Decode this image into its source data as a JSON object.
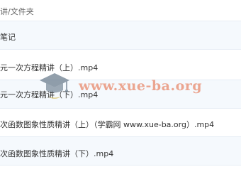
{
  "header": {
    "title": "讲/文件夹"
  },
  "files": [
    {
      "name": "笔记"
    },
    {
      "name": "元一次方程精讲（上）.mp4"
    },
    {
      "name": "元一次方程精讲（下）.mp4"
    },
    {
      "name": "次函数图象性质精讲（上）（学霸网 www.xue-ba.org）.mp4"
    },
    {
      "name": "次函数图象性质精讲（下）.mp4"
    }
  ],
  "watermark": {
    "text": "www.xue-ba.org",
    "icon": "graduation-cap-icon",
    "color": "#e8896c"
  },
  "colors": {
    "row_alt": "#f5f9fd",
    "divider": "#e6edf5"
  }
}
